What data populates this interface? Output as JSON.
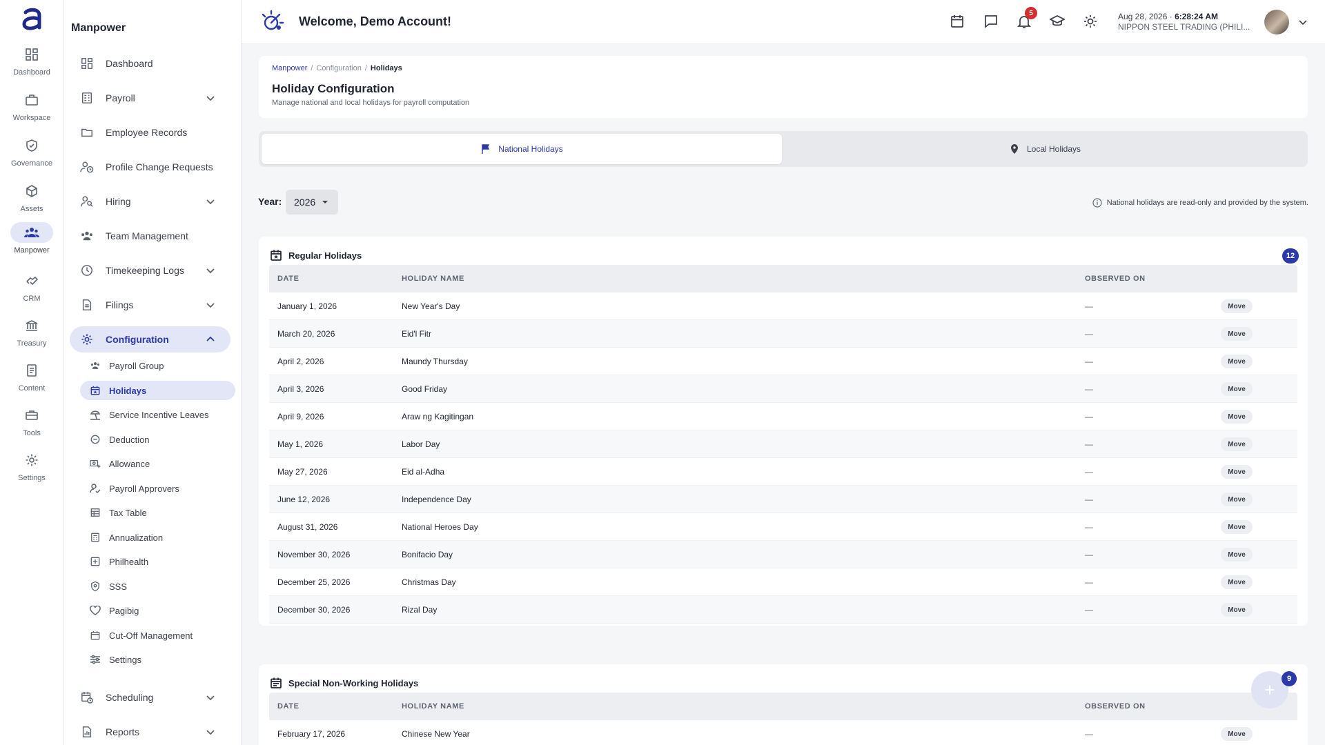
{
  "rail": [
    {
      "label": "Dashboard",
      "icon": "grid-icon"
    },
    {
      "label": "Workspace",
      "icon": "briefcase-icon"
    },
    {
      "label": "Governance",
      "icon": "shield-check-icon"
    },
    {
      "label": "Assets",
      "icon": "cube-icon"
    },
    {
      "label": "Manpower",
      "icon": "people-icon",
      "active": true
    },
    {
      "label": "CRM",
      "icon": "handshake-icon"
    },
    {
      "label": "Treasury",
      "icon": "bank-icon"
    },
    {
      "label": "Content",
      "icon": "document-icon"
    },
    {
      "label": "Tools",
      "icon": "toolbox-icon"
    },
    {
      "label": "Settings",
      "icon": "gear-icon"
    }
  ],
  "sidebar": {
    "title": "Manpower",
    "items": [
      {
        "label": "Dashboard"
      },
      {
        "label": "Payroll"
      },
      {
        "label": "Employee Records"
      },
      {
        "label": "Profile Change Requests"
      },
      {
        "label": "Hiring"
      },
      {
        "label": "Team Management"
      },
      {
        "label": "Timekeeping Logs"
      },
      {
        "label": "Filings"
      },
      {
        "label": "Configuration"
      },
      {
        "label": "Scheduling"
      },
      {
        "label": "Reports"
      }
    ],
    "config_children": [
      {
        "label": "Payroll Group"
      },
      {
        "label": "Holidays"
      },
      {
        "label": "Service Incentive Leaves"
      },
      {
        "label": "Deduction"
      },
      {
        "label": "Allowance"
      },
      {
        "label": "Payroll Approvers"
      },
      {
        "label": "Tax Table"
      },
      {
        "label": "Annualization"
      },
      {
        "label": "Philhealth"
      },
      {
        "label": "SSS"
      },
      {
        "label": "Pagibig"
      },
      {
        "label": "Cut-Off Management"
      },
      {
        "label": "Settings"
      }
    ]
  },
  "header": {
    "welcome": "Welcome, Demo Account!",
    "notification_count": "5",
    "date": "Aug 28, 2026 ·",
    "time": "6:28:24 AM",
    "company": "NIPPON STEEL TRADING (PHILI..."
  },
  "page": {
    "breadcrumb": [
      "Manpower",
      "Configuration",
      "Holidays"
    ],
    "title": "Holiday Configuration",
    "subtitle": "Manage national and local holidays for payroll computation",
    "tabs": [
      "National Holidays",
      "Local Holidays"
    ],
    "year_label": "Year:",
    "year_value": "2026",
    "note": "National holidays are read-only and provided by the system."
  },
  "table_headers": [
    "DATE",
    "HOLIDAY NAME",
    "OBSERVED ON"
  ],
  "regular": {
    "title": "Regular Holidays",
    "count": "12",
    "rows": [
      {
        "date": "January 1, 2026",
        "name": "New Year's Day",
        "observed": "—",
        "action": "Move"
      },
      {
        "date": "March 20, 2026",
        "name": "Eid'l Fitr",
        "observed": "—",
        "action": "Move"
      },
      {
        "date": "April 2, 2026",
        "name": "Maundy Thursday",
        "observed": "—",
        "action": "Move"
      },
      {
        "date": "April 3, 2026",
        "name": "Good Friday",
        "observed": "—",
        "action": "Move"
      },
      {
        "date": "April 9, 2026",
        "name": "Araw ng Kagitingan",
        "observed": "—",
        "action": "Move"
      },
      {
        "date": "May 1, 2026",
        "name": "Labor Day",
        "observed": "—",
        "action": "Move"
      },
      {
        "date": "May 27, 2026",
        "name": "Eid al-Adha",
        "observed": "—",
        "action": "Move"
      },
      {
        "date": "June 12, 2026",
        "name": "Independence Day",
        "observed": "—",
        "action": "Move"
      },
      {
        "date": "August 31, 2026",
        "name": "National Heroes Day",
        "observed": "—",
        "action": "Move"
      },
      {
        "date": "November 30, 2026",
        "name": "Bonifacio Day",
        "observed": "—",
        "action": "Move"
      },
      {
        "date": "December 25, 2026",
        "name": "Christmas Day",
        "observed": "—",
        "action": "Move"
      },
      {
        "date": "December 30, 2026",
        "name": "Rizal Day",
        "observed": "—",
        "action": "Move"
      }
    ]
  },
  "special": {
    "title": "Special Non-Working Holidays",
    "count": "9",
    "rows": [
      {
        "date": "February 17, 2026",
        "name": "Chinese New Year",
        "observed": "—",
        "action": "Move"
      }
    ]
  },
  "fab": {
    "label": "+"
  }
}
